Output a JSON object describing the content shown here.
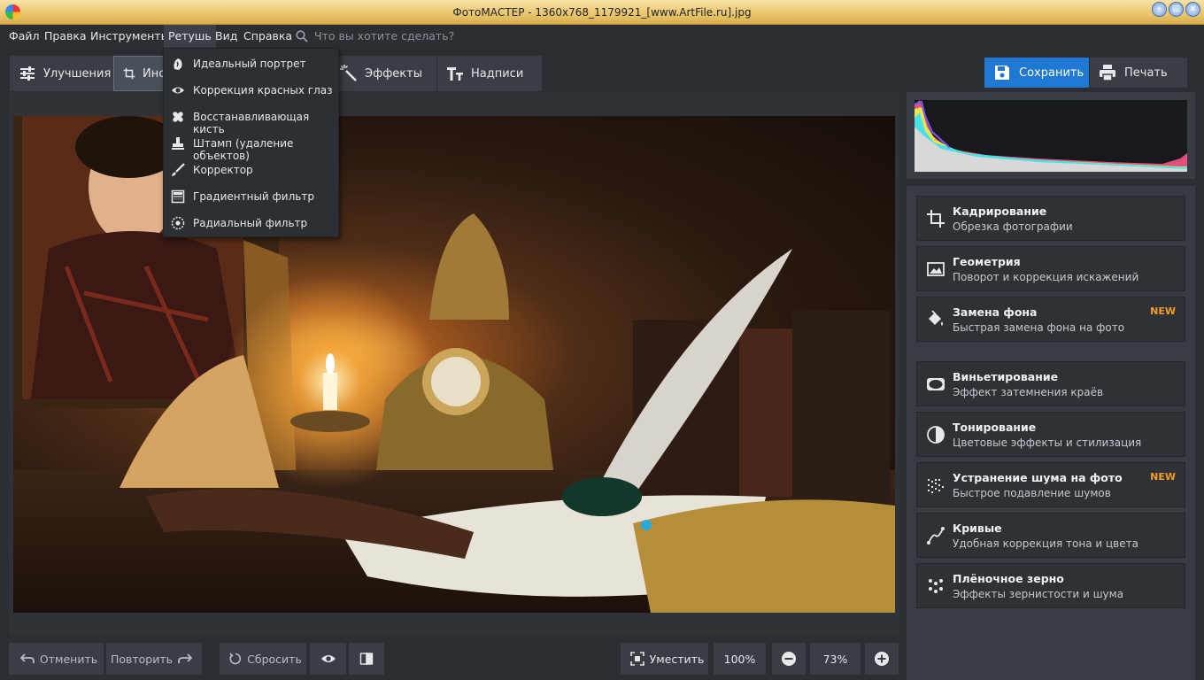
{
  "window": {
    "title": "ФотоМАСТЕР - 1360x768_1179921_[www.ArtFile.ru].jpg"
  },
  "menu": {
    "items": [
      "Файл",
      "Правка",
      "Инструменты",
      "Ретушь",
      "Вид",
      "Справка"
    ],
    "active": "Ретушь",
    "search_placeholder": "Что вы хотите сделать?"
  },
  "tabs": [
    {
      "label": "Улучшения",
      "icon": "sliders-icon"
    },
    {
      "label": "Инструменты",
      "icon": "crop-icon",
      "active": true
    },
    {
      "label": "Эффекты",
      "icon": "magic-wand-icon"
    },
    {
      "label": "Надписи",
      "icon": "text-icon"
    }
  ],
  "actions": {
    "save": "Сохранить",
    "print": "Печать"
  },
  "retouch_menu": [
    {
      "label": "Идеальный портрет",
      "icon": "portrait-icon"
    },
    {
      "label": "Коррекция красных глаз",
      "icon": "eye-icon"
    },
    {
      "label": "Восстанавливающая кисть",
      "icon": "bandage-icon"
    },
    {
      "label": "Штамп (удаление объектов)",
      "icon": "stamp-icon"
    },
    {
      "label": "Корректор",
      "icon": "brush-icon"
    },
    {
      "label": "Градиентный фильтр",
      "icon": "gradient-filter-icon"
    },
    {
      "label": "Радиальный фильтр",
      "icon": "radial-filter-icon"
    }
  ],
  "effects": [
    {
      "name": "Кадрирование",
      "desc": "Обрезка фотографии",
      "icon": "crop-icon",
      "badge": ""
    },
    {
      "name": "Геометрия",
      "desc": "Поворот и коррекция искажений",
      "icon": "geometry-icon",
      "badge": ""
    },
    {
      "name": "Замена фона",
      "desc": "Быстрая замена фона на фото",
      "icon": "paint-bucket-icon",
      "badge": "NEW"
    },
    {
      "name": "Виньетирование",
      "desc": "Эффект затемнения краёв",
      "icon": "vignette-icon",
      "badge": ""
    },
    {
      "name": "Тонирование",
      "desc": "Цветовые эффекты и стилизация",
      "icon": "toning-icon",
      "badge": ""
    },
    {
      "name": "Устранение шума на фото",
      "desc": "Быстрое подавление шумов",
      "icon": "noise-icon",
      "badge": "NEW"
    },
    {
      "name": "Кривые",
      "desc": "Удобная коррекция тона и цвета",
      "icon": "curves-icon",
      "badge": ""
    },
    {
      "name": "Плёночное зерно",
      "desc": "Эффекты зернистости и шума",
      "icon": "grain-icon",
      "badge": ""
    }
  ],
  "bottom": {
    "undo": "Отменить",
    "redo": "Повторить",
    "reset": "Сбросить",
    "fit": "Уместить",
    "zoom_100": "100%",
    "zoom_current": "73%"
  },
  "colors": {
    "accent": "#1f78d1",
    "badge": "#f59d23",
    "panel": "#383c42"
  }
}
